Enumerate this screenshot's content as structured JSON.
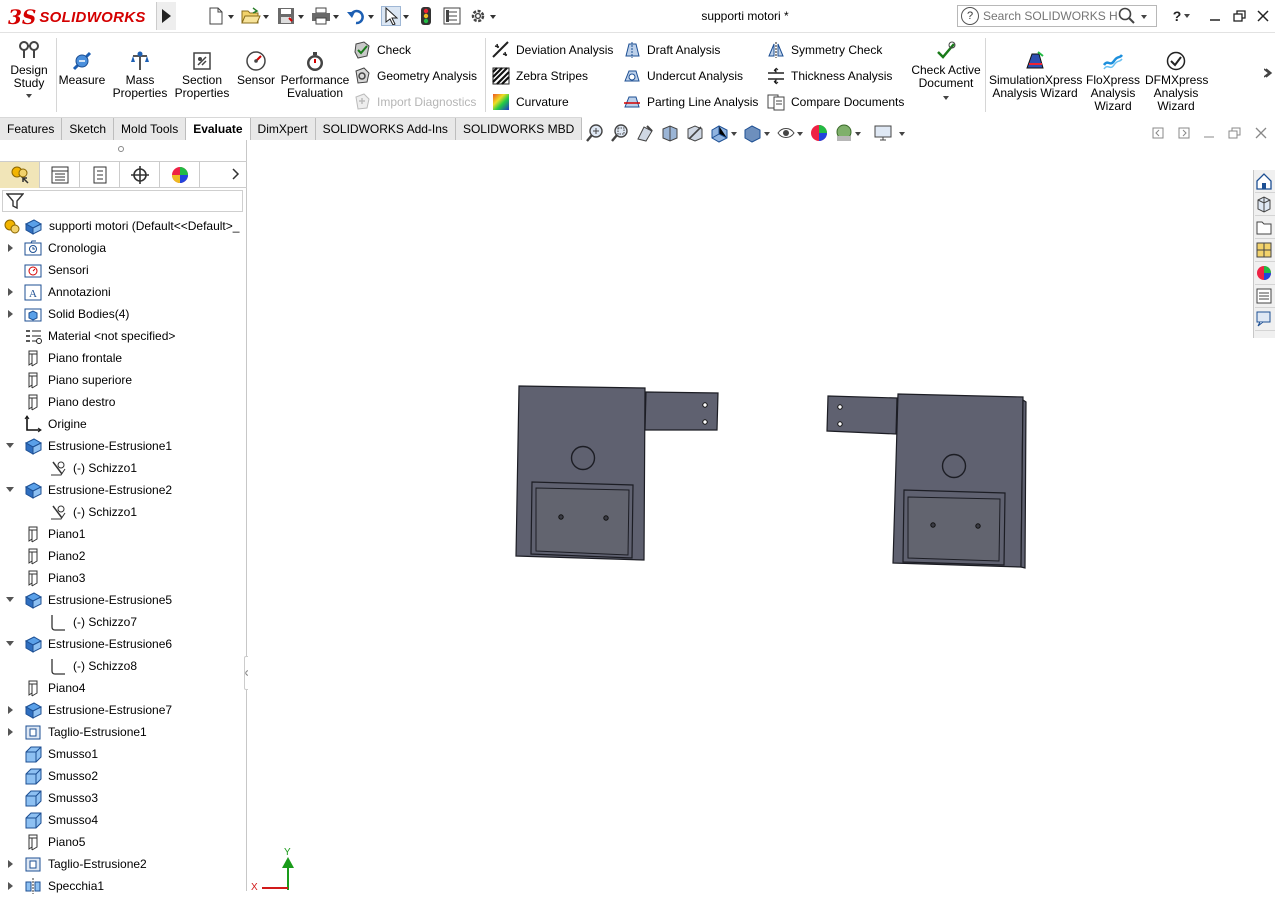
{
  "app": {
    "logo_ds": "3S",
    "logo_text": "SOLIDWORKS",
    "document_title": "supporti motori *"
  },
  "search": {
    "placeholder": "Search SOLIDWORKS Help"
  },
  "help_label": "?",
  "colors": {
    "accent_red": "#d40000",
    "model_body": "#5f6170",
    "model_edge": "#1c1d24",
    "active_tab_bg": "#ffffff",
    "tab_bg": "#e8e8e8",
    "triad_green": "#1a9b1a",
    "triad_red": "#d11a1a"
  },
  "ribbon": {
    "design_study": "Design Study",
    "measure": "Measure",
    "mass_properties": "Mass Properties",
    "section_properties": "Section Properties",
    "sensor": "Sensor",
    "performance_evaluation": "Performance Evaluation",
    "check": "Check",
    "geometry_analysis": "Geometry Analysis",
    "import_diagnostics": "Import Diagnostics",
    "deviation_analysis": "Deviation Analysis",
    "zebra_stripes": "Zebra Stripes",
    "curvature": "Curvature",
    "draft_analysis": "Draft Analysis",
    "undercut_analysis": "Undercut Analysis",
    "parting_line_analysis": "Parting Line Analysis",
    "symmetry_check": "Symmetry Check",
    "thickness_analysis": "Thickness Analysis",
    "compare_documents": "Compare Documents",
    "check_active_document": "Check Active Document",
    "simulationxpress": "SimulationXpress Analysis Wizard",
    "floxpress": "FloXpress Analysis Wizard",
    "dfmxpress": "DFMXpress Analysis Wizard"
  },
  "tabs": [
    {
      "label": "Features"
    },
    {
      "label": "Sketch"
    },
    {
      "label": "Mold Tools"
    },
    {
      "label": "Evaluate"
    },
    {
      "label": "DimXpert"
    },
    {
      "label": "SOLIDWORKS Add-Ins"
    },
    {
      "label": "SOLIDWORKS MBD"
    }
  ],
  "active_tab": "Evaluate",
  "tree": {
    "root": "supporti motori  (Default<<Default>_",
    "items": [
      {
        "label": "Cronologia",
        "icon": "history-folder-icon"
      },
      {
        "label": "Sensori",
        "icon": "sensor-folder-icon"
      },
      {
        "label": "Annotazioni",
        "icon": "annotations-icon"
      },
      {
        "label": "Solid Bodies(4)",
        "icon": "solid-bodies-icon"
      },
      {
        "label": "Material <not specified>",
        "icon": "material-icon"
      },
      {
        "label": "Piano frontale",
        "icon": "plane-icon"
      },
      {
        "label": "Piano superiore",
        "icon": "plane-icon"
      },
      {
        "label": "Piano destro",
        "icon": "plane-icon"
      },
      {
        "label": "Origine",
        "icon": "origin-icon"
      },
      {
        "label": "Estrusione-Estrusione1",
        "icon": "extrude-icon"
      },
      {
        "label": "(-) Schizzo1",
        "icon": "sketch-icon"
      },
      {
        "label": "Estrusione-Estrusione2",
        "icon": "extrude-icon"
      },
      {
        "label": "(-) Schizzo1",
        "icon": "sketch-icon"
      },
      {
        "label": "Piano1",
        "icon": "plane-icon"
      },
      {
        "label": "Piano2",
        "icon": "plane-icon"
      },
      {
        "label": "Piano3",
        "icon": "plane-icon"
      },
      {
        "label": "Estrusione-Estrusione5",
        "icon": "extrude-icon"
      },
      {
        "label": "(-) Schizzo7",
        "icon": "sketch-icon"
      },
      {
        "label": "Estrusione-Estrusione6",
        "icon": "extrude-icon"
      },
      {
        "label": "(-) Schizzo8",
        "icon": "sketch-icon"
      },
      {
        "label": "Piano4",
        "icon": "plane-icon"
      },
      {
        "label": "Estrusione-Estrusione7",
        "icon": "extrude-icon"
      },
      {
        "label": "Taglio-Estrusione1",
        "icon": "cut-extrude-icon"
      },
      {
        "label": "Smusso1",
        "icon": "chamfer-icon"
      },
      {
        "label": "Smusso2",
        "icon": "chamfer-icon"
      },
      {
        "label": "Smusso3",
        "icon": "chamfer-icon"
      },
      {
        "label": "Smusso4",
        "icon": "chamfer-icon"
      },
      {
        "label": "Piano5",
        "icon": "plane-icon"
      },
      {
        "label": "Taglio-Estrusione2",
        "icon": "cut-extrude-icon"
      },
      {
        "label": "Specchia1",
        "icon": "mirror-icon"
      }
    ]
  },
  "triad": {
    "y_label": "Y",
    "x_label": "X"
  }
}
